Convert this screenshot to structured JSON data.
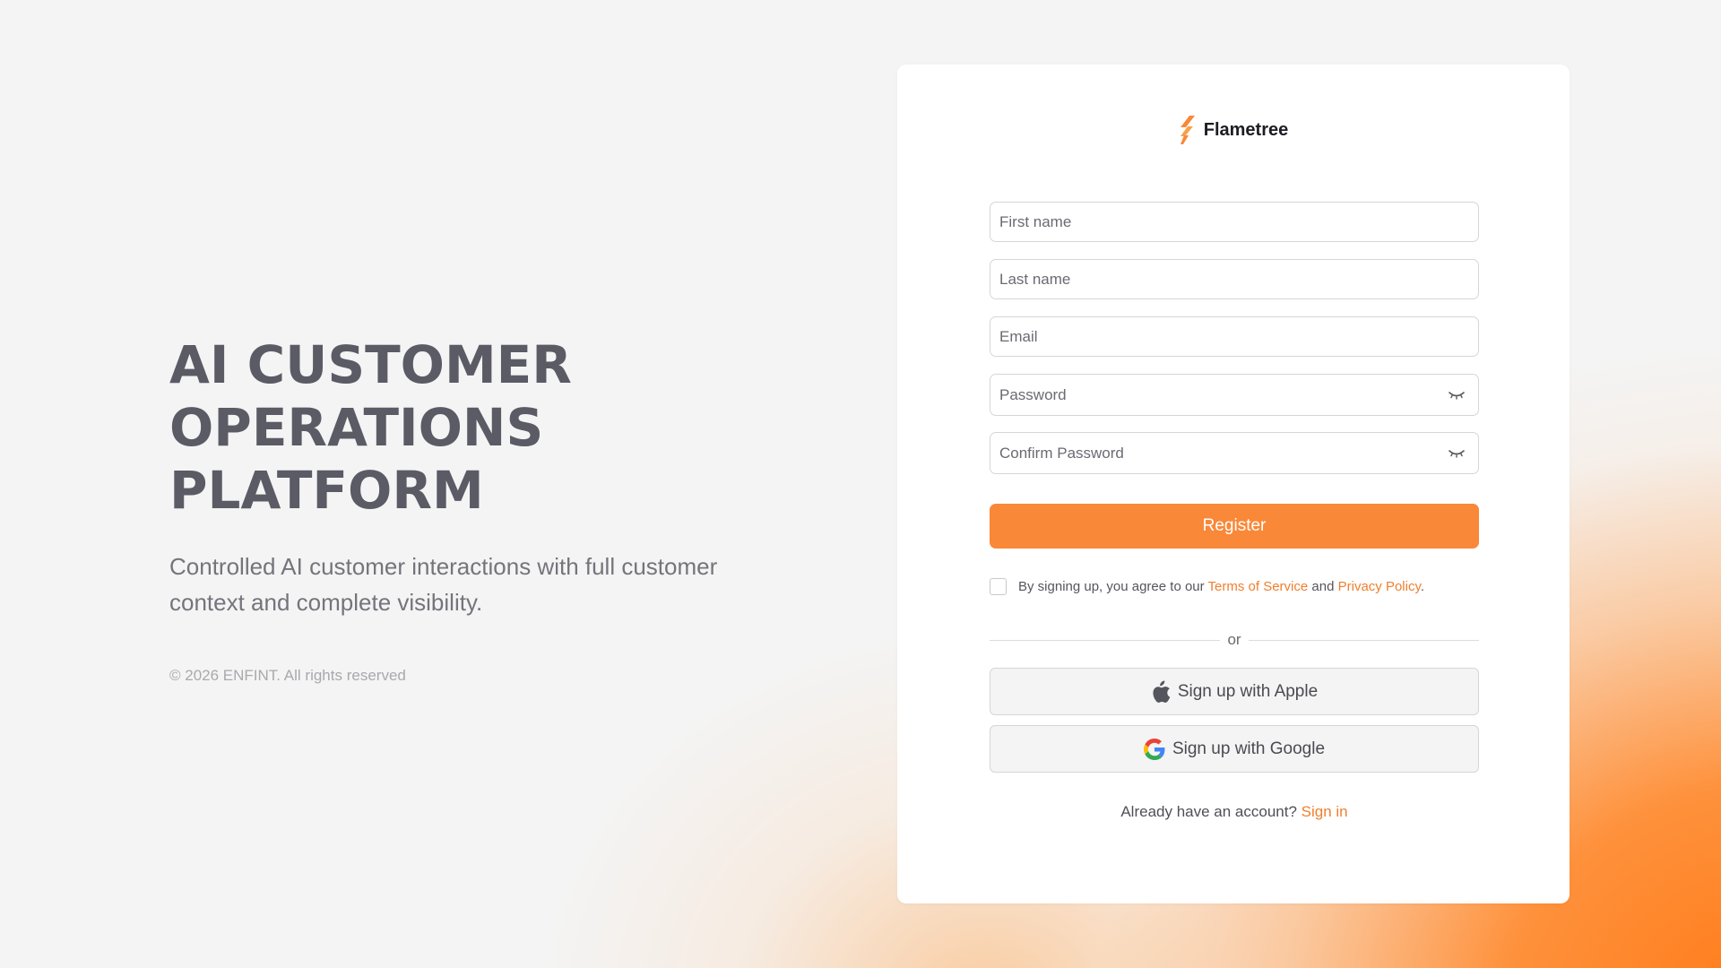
{
  "hero": {
    "title_lines": [
      "AI CUSTOMER",
      "OPERATIONS",
      "PLATFORM"
    ],
    "subtitle": "Controlled AI customer interactions with full customer context and complete visibility.",
    "copyright": "© 2026 ENFINT. All rights reserved"
  },
  "brand": {
    "name": "Flametree",
    "logo_icon": "flame-logo-icon",
    "accent_color": "#f98838"
  },
  "form": {
    "first_name_placeholder": "First name",
    "last_name_placeholder": "Last name",
    "email_placeholder": "Email",
    "password_placeholder": "Password",
    "confirm_password_placeholder": "Confirm Password",
    "register_label": "Register",
    "terms_prefix": "By signing up, you agree to our ",
    "terms_link": "Terms of Service",
    "terms_and": " and ",
    "privacy_link": "Privacy Policy",
    "terms_suffix": ".",
    "terms_checked": false,
    "divider_text": "or",
    "apple_label": "Sign up with Apple",
    "google_label": "Sign up with Google",
    "signin_prompt": "Already have an account? ",
    "signin_link": "Sign in"
  }
}
